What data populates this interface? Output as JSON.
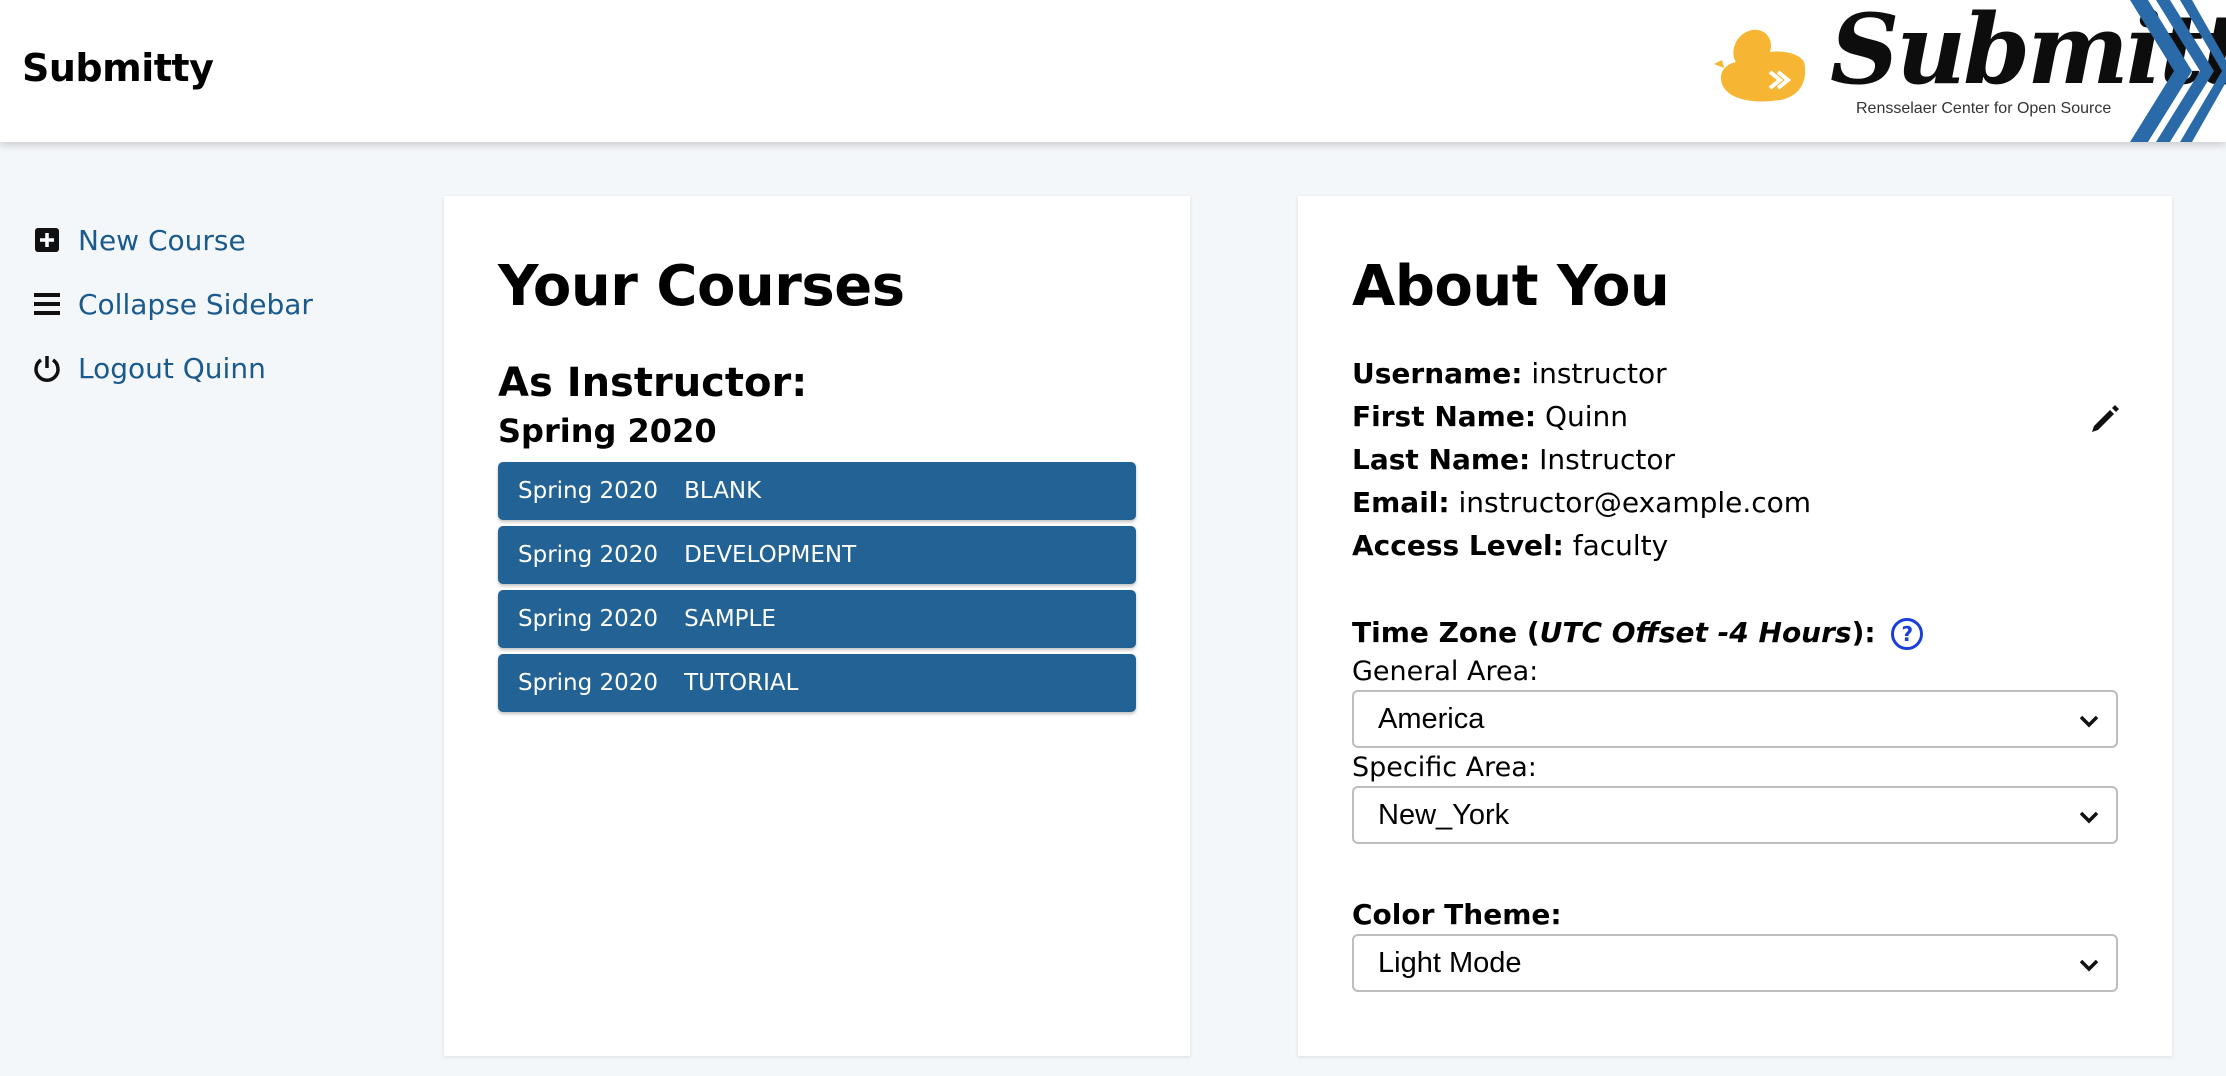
{
  "header": {
    "site_title": "Submitty",
    "logo_text": "Submitty",
    "logo_subtitle": "Rensselaer Center for Open Source"
  },
  "sidebar": {
    "items": [
      {
        "label": "New Course",
        "icon": "plus-square-icon"
      },
      {
        "label": "Collapse Sidebar",
        "icon": "bars-icon"
      },
      {
        "label": "Logout Quinn",
        "icon": "power-icon"
      }
    ]
  },
  "courses": {
    "title": "Your Courses",
    "role_heading": "As Instructor:",
    "term_heading": "Spring 2020",
    "items": [
      {
        "term": "Spring 2020",
        "name": "BLANK"
      },
      {
        "term": "Spring 2020",
        "name": "DEVELOPMENT"
      },
      {
        "term": "Spring 2020",
        "name": "SAMPLE"
      },
      {
        "term": "Spring 2020",
        "name": "TUTORIAL"
      }
    ]
  },
  "about": {
    "title": "About You",
    "fields": [
      {
        "label": "Username:",
        "value": "instructor"
      },
      {
        "label": "First Name:",
        "value": "Quinn"
      },
      {
        "label": "Last Name:",
        "value": "Instructor"
      },
      {
        "label": "Email:",
        "value": "instructor@example.com"
      },
      {
        "label": "Access Level:",
        "value": "faculty"
      }
    ],
    "timezone": {
      "label_prefix": "Time Zone (",
      "offset": "UTC Offset -4 Hours",
      "label_suffix": "):",
      "help_glyph": "?",
      "general_label": "General Area:",
      "general_value": "America",
      "specific_label": "Specific Area:",
      "specific_value": "New_York"
    },
    "color_theme": {
      "label": "Color Theme:",
      "value": "Light Mode"
    }
  },
  "colors": {
    "accent": "#226295",
    "link": "#1a5a8c",
    "background": "#f4f7fa",
    "logo_yellow": "#f6b532",
    "logo_blue": "#2a6aa8"
  }
}
